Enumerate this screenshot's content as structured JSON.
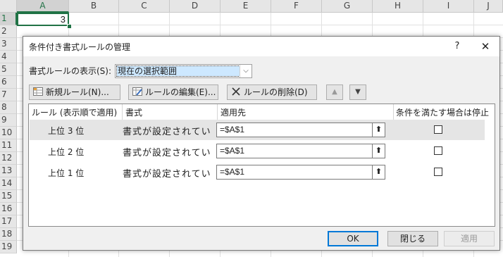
{
  "spreadsheet": {
    "columns": [
      "A",
      "B",
      "C",
      "D",
      "E",
      "F",
      "G",
      "H",
      "I",
      "J"
    ],
    "rows": [
      "1",
      "2",
      "3",
      "4",
      "5",
      "6",
      "7",
      "8",
      "9",
      "10",
      "11",
      "12",
      "13",
      "14",
      "15",
      "16",
      "17",
      "18",
      "19"
    ],
    "active_cell_value": "3"
  },
  "dialog": {
    "title": "条件付き書式ルールの管理",
    "help": "?",
    "close": "✕",
    "show_label": "書式ルールの表示(S):",
    "scope_value": "現在の選択範囲",
    "toolbar": {
      "new_rule": "新規ルール(N)...",
      "edit_rule": "ルールの編集(E)...",
      "delete_rule": "ルールの削除(D)",
      "move_up": "▲",
      "move_down": "▼"
    },
    "table": {
      "headers": [
        "ルール (表示順で適用)",
        "書式",
        "適用先",
        "条件を満たす場合は停止"
      ],
      "rows": [
        {
          "rule": "上位 3 位",
          "format": "書式が設定されてい",
          "applies_to": "=$A$1",
          "stop": false
        },
        {
          "rule": "上位 2 位",
          "format": "書式が設定されてい",
          "applies_to": "=$A$1",
          "stop": false
        },
        {
          "rule": "上位 1 位",
          "format": "書式が設定されてい",
          "applies_to": "=$A$1",
          "stop": false
        }
      ]
    },
    "buttons": {
      "ok": "OK",
      "close": "閉じる",
      "apply": "適用"
    }
  },
  "colors": {
    "excel_green": "#217346",
    "selection_blue": "#cde8ff",
    "ok_border": "#0078d7"
  }
}
